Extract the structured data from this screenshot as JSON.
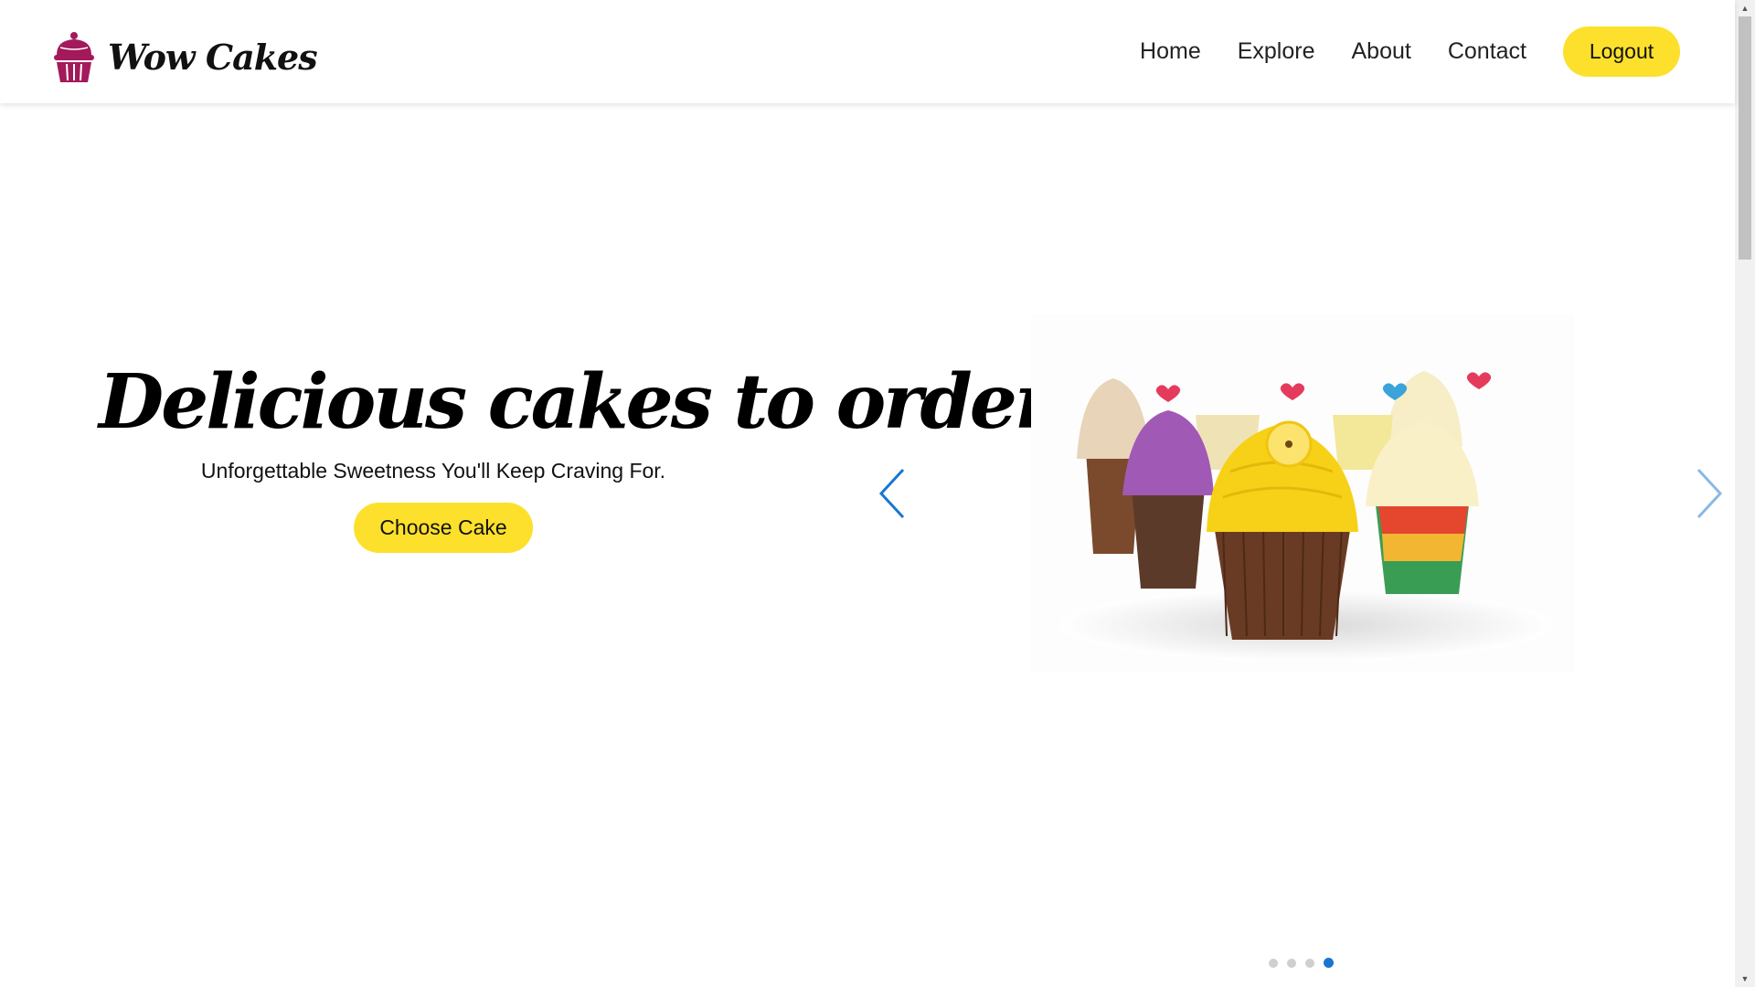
{
  "brand": {
    "name": "Wow Cakes",
    "icon": "cupcake-icon",
    "icon_color": "#a3195b"
  },
  "nav": {
    "items": [
      {
        "label": "Home"
      },
      {
        "label": "Explore"
      },
      {
        "label": "About"
      },
      {
        "label": "Contact"
      }
    ],
    "logout_label": "Logout"
  },
  "hero": {
    "title": "Delicious cakes to order",
    "subtitle": "Unforgettable Sweetness You'll Keep Craving For.",
    "cta_label": "Choose Cake"
  },
  "carousel": {
    "prev_icon": "chevron-left-icon",
    "next_icon": "chevron-right-icon",
    "slide_image": "cupcakes-photo",
    "slide_count": 4,
    "active_slide": 4
  },
  "loading_progress": 0.2,
  "colors": {
    "accent_yellow": "#fde02c",
    "brand_magenta": "#a3195b",
    "carousel_blue": "#1976d2"
  }
}
